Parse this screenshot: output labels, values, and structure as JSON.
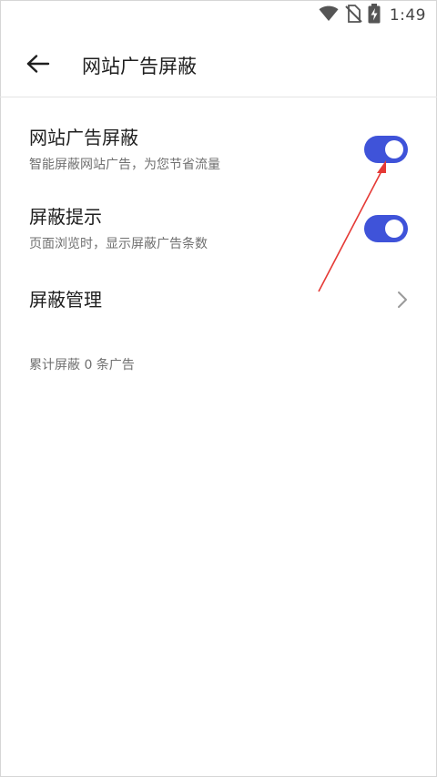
{
  "status_bar": {
    "time": "1:49",
    "icons": [
      "wifi-icon",
      "no-sim-icon",
      "battery-charging-icon"
    ]
  },
  "app_bar": {
    "back_icon": "arrow-left-icon",
    "title": "网站广告屏蔽"
  },
  "settings": {
    "ad_block": {
      "title": "网站广告屏蔽",
      "subtitle": "智能屏蔽网站广告，为您节省流量",
      "enabled": true
    },
    "block_hint": {
      "title": "屏蔽提示",
      "subtitle": "页面浏览时，显示屏蔽广告条数",
      "enabled": true
    },
    "block_manage": {
      "title": "屏蔽管理",
      "icon": "chevron-right-icon"
    }
  },
  "footer": {
    "blocked_count_text": "累计屏蔽 0 条广告"
  },
  "colors": {
    "accent": "#3f53d9",
    "annotation_arrow": "#e53935",
    "title_text": "#1f1f1f",
    "secondary_text": "#707070"
  }
}
